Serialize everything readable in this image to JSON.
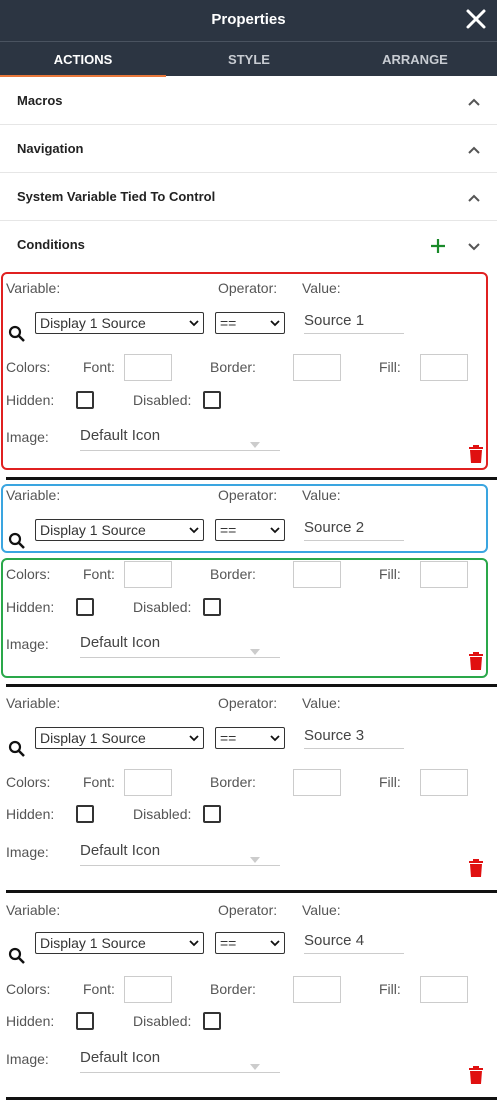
{
  "panel": {
    "title": "Properties"
  },
  "tabs": [
    {
      "label": "ACTIONS",
      "active": true
    },
    {
      "label": "STYLE",
      "active": false
    },
    {
      "label": "ARRANGE",
      "active": false
    }
  ],
  "sections": [
    {
      "label": "Macros"
    },
    {
      "label": "Navigation"
    },
    {
      "label": "System Variable Tied To Control"
    },
    {
      "label": "Conditions"
    }
  ],
  "labels": {
    "variable": "Variable:",
    "operator": "Operator:",
    "value": "Value:",
    "colors": "Colors:",
    "font": "Font:",
    "border": "Border:",
    "fill": "Fill:",
    "hidden": "Hidden:",
    "disabled": "Disabled:",
    "image": "Image:"
  },
  "conditions": [
    {
      "variable": "Display 1 Source",
      "operator": "==",
      "value": "Source 1",
      "image": "Default Icon"
    },
    {
      "variable": "Display 1 Source",
      "operator": "==",
      "value": "Source 2",
      "image": "Default Icon"
    },
    {
      "variable": "Display 1 Source",
      "operator": "==",
      "value": "Source 3",
      "image": "Default Icon"
    },
    {
      "variable": "Display 1 Source",
      "operator": "==",
      "value": "Source 4",
      "image": "Default Icon"
    }
  ],
  "colors": {
    "header_bg": "#2c3542",
    "tab_underline": "#e8773a",
    "highlight_red": "#e02020",
    "highlight_blue": "#3aa5e0",
    "highlight_green": "#2aa84a",
    "trash": "#e01010",
    "plus": "#1a8a2a"
  }
}
